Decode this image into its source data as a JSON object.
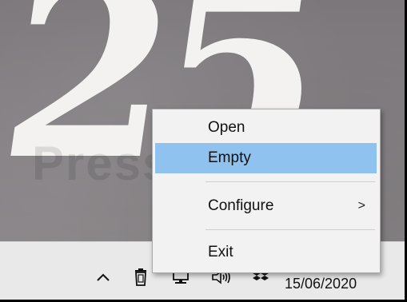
{
  "wallpaper": {
    "number_text": "25",
    "watermark_text": "Pressure"
  },
  "context_menu": {
    "items": [
      {
        "label": "Open",
        "highlighted": false,
        "has_submenu": false
      },
      {
        "label": "Empty",
        "highlighted": true,
        "has_submenu": false
      },
      {
        "label": "Configure",
        "highlighted": false,
        "has_submenu": true,
        "submenu_glyph": ">"
      },
      {
        "label": "Exit",
        "highlighted": false,
        "has_submenu": false
      }
    ],
    "highlight_color": "#8fc2ee"
  },
  "taskbar": {
    "tray_icons": [
      "show-hidden-icons-chevron",
      "recycle-bin-icon",
      "network-icon",
      "volume-icon",
      "dropbox-icon"
    ],
    "date": "15/06/2020"
  }
}
